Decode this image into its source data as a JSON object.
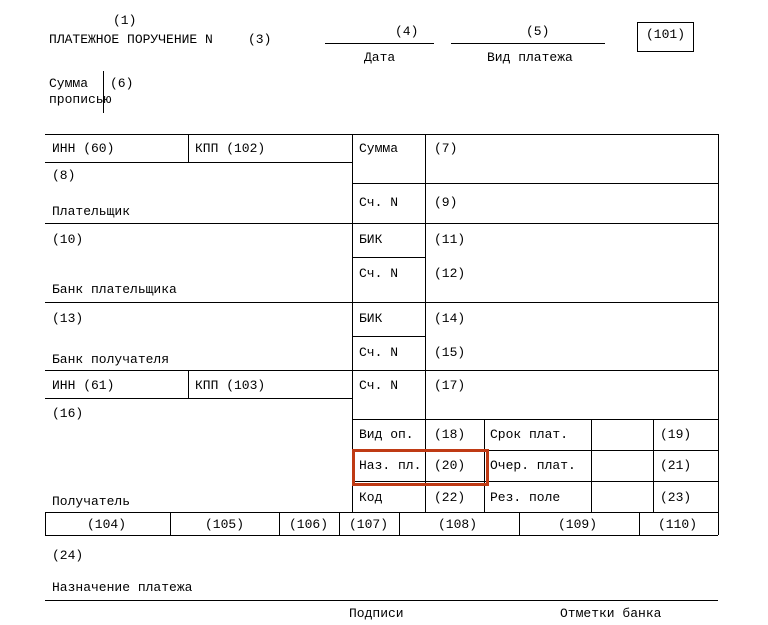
{
  "header": {
    "num_top": "(1)",
    "title": "ПЛАТЕЖНОЕ ПОРУЧЕНИЕ N",
    "num_after_n": "(3)",
    "date_num": "(4)",
    "date_lbl": "Дата",
    "pay_kind_num": "(5)",
    "pay_kind_lbl": "Вид платежа",
    "box_101": "(101)"
  },
  "sum_words": {
    "lbl1": "Сумма",
    "lbl2": "прописью",
    "num": "(6)"
  },
  "main": {
    "inn60": "ИНН (60)",
    "kpp102": "КПП (102)",
    "summa": "Сумма",
    "r7": "(7)",
    "r8": "(8)",
    "payer": "Плательщик",
    "sch_n1": "Сч. N",
    "r9": "(9)",
    "r10": "(10)",
    "payer_bank": "Банк плательщика",
    "bik1": "БИК",
    "r11": "(11)",
    "sch_n2": "Сч. N",
    "r12": "(12)",
    "r13": "(13)",
    "payee_bank": "Банк получателя",
    "bik2": "БИК",
    "r14": "(14)",
    "sch_n3": "Сч. N",
    "r15": "(15)",
    "inn61": "ИНН (61)",
    "kpp103": "КПП (103)",
    "sch_n4": "Сч. N",
    "r17": "(17)",
    "r16": "(16)",
    "payee": "Получатель",
    "vid_op": "Вид оп.",
    "r18": "(18)",
    "srok": "Срок плат.",
    "r19": "(19)",
    "naz_pl": "Наз. пл.",
    "r20": "(20)",
    "ocher": "Очер. плат.",
    "r21": "(21)",
    "kod": "Код",
    "r22": "(22)",
    "rez": "Рез. поле",
    "r23": "(23)"
  },
  "codes": {
    "c104": "(104)",
    "c105": "(105)",
    "c106": "(106)",
    "c107": "(107)",
    "c108": "(108)",
    "c109": "(109)",
    "c110": "(110)"
  },
  "footer": {
    "r24": "(24)",
    "purpose": "Назначение платежа",
    "signs": "Подписи",
    "bank_marks": "Отметки банка"
  }
}
